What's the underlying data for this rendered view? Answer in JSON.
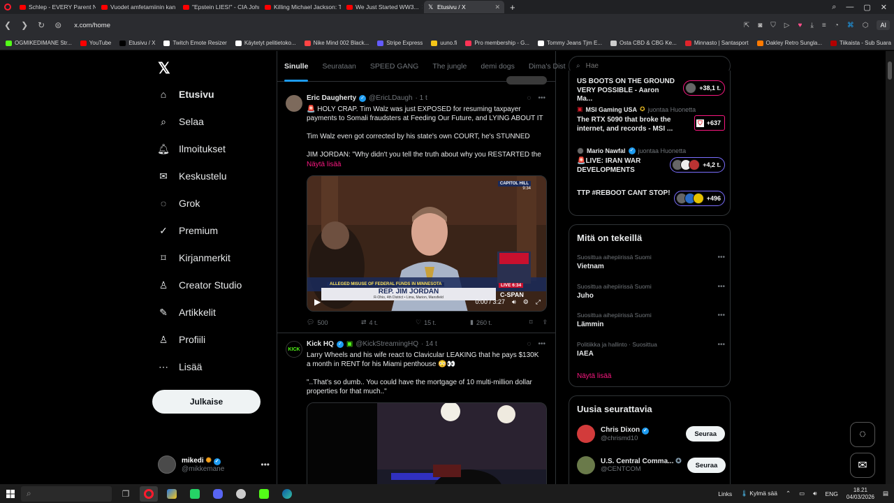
{
  "browser": {
    "tabs": [
      {
        "label": "Schlep - EVERY Parent Ne",
        "icon": "youtube-icon"
      },
      {
        "label": "Vuodet amfetamiinin kan",
        "icon": "youtube-icon"
      },
      {
        "label": "\"Epstein LIES!\" - CIA John",
        "icon": "youtube-icon"
      },
      {
        "label": "Killing Michael Jackson: Th",
        "icon": "youtube-icon"
      },
      {
        "label": "We Just Started WW3...",
        "icon": "youtube-icon"
      },
      {
        "label": "Etusivu / X",
        "icon": "x-icon",
        "active": true
      }
    ],
    "url": "x.com/home",
    "ai_label": "AI",
    "bookmarks": [
      {
        "label": "OGMIKEDIMANE Str...",
        "color": "#53fc18"
      },
      {
        "label": "YouTube",
        "color": "#ff0000"
      },
      {
        "label": "Etusivu / X",
        "color": "#000000"
      },
      {
        "label": "Twitch Emote Resizer",
        "color": "#ffffff"
      },
      {
        "label": "Käytetyt pelitietoko...",
        "color": "#ffffff"
      },
      {
        "label": "Nike Mind 002 Black...",
        "color": "#ff4444"
      },
      {
        "label": "Stripe Express",
        "color": "#635bff"
      },
      {
        "label": "uuno.fi",
        "color": "#f5c518"
      },
      {
        "label": "Pro membership - G...",
        "color": "#ff3355"
      },
      {
        "label": "Tommy Jeans Tjm E...",
        "color": "#ffffff"
      },
      {
        "label": "Osta CBD & CBG Ke...",
        "color": "#cccccc"
      },
      {
        "label": "Minnasto | Santasport",
        "color": "#e0242b"
      },
      {
        "label": "Oakley Retro Sungla...",
        "color": "#ff7a00"
      },
      {
        "label": "Tiikaista - Sub Suara",
        "color": "#b30000"
      }
    ]
  },
  "nav": {
    "items": [
      {
        "label": "Etusivu",
        "icon": "home-icon",
        "active": true
      },
      {
        "label": "Selaa",
        "icon": "search-icon"
      },
      {
        "label": "Ilmoitukset",
        "icon": "bell-icon"
      },
      {
        "label": "Keskustelu",
        "icon": "mail-icon"
      },
      {
        "label": "Grok",
        "icon": "grok-icon"
      },
      {
        "label": "Premium",
        "icon": "premium-icon"
      },
      {
        "label": "Kirjanmerkit",
        "icon": "bookmark-icon"
      },
      {
        "label": "Creator Studio",
        "icon": "creator-icon"
      },
      {
        "label": "Artikkelit",
        "icon": "article-icon"
      },
      {
        "label": "Profiili",
        "icon": "profile-icon"
      },
      {
        "label": "Lisää",
        "icon": "more-icon"
      }
    ],
    "post_label": "Julkaise",
    "profile": {
      "name": "mikedi",
      "handle": "@mikkemane"
    }
  },
  "feed": {
    "tabs": [
      "Sinulle",
      "Seurataan",
      "SPEED GANG",
      "The jungle",
      "demi dogs",
      "Dima's Dist"
    ],
    "tweets": [
      {
        "name": "Eric Daugherty",
        "handle": "@EricLDaugh",
        "time": "· 1 t",
        "text": "🚨 HOLY CRAP. Tim Walz was just EXPOSED for resuming taxpayer payments to Somali fraudsters at Feeding Our Future, and LYING ABOUT IT\n\nTim Walz even got corrected by his state's own COURT, he's STUNNED\n\nJIM JORDAN: \"Why didn't you tell the truth about why you RESTARTED the",
        "show_more": "Näytä lisää",
        "video": {
          "banner": "ALLEGED MISUSE OF FEDERAL FUNDS IN MINNESOTA",
          "name": "REP. JIM JORDAN",
          "sub": "R-Ohio, 4th District  •  Lima, Marion, Mansfield",
          "channel": "CAPITOL HILL",
          "channel_time": "9:34",
          "live": "LIVE",
          "live_time": "6:34",
          "network": "C-SPAN",
          "time": "0:00 / 3:27"
        },
        "stats": {
          "replies": "500",
          "reposts": "4 t.",
          "likes": "15 t.",
          "views": "260 t."
        }
      },
      {
        "name": "Kick HQ",
        "handle": "@KickStreamingHQ",
        "time": "· 14 t",
        "text": "Larry Wheels and his wife react to Clavicular LEAKING that he pays $130K a month in RENT for his Miami penthouse 😳👀\n\n\"..That's so dumb.. You could have the mortgage of 10 multi-million dollar properties for that much..\""
      }
    ]
  },
  "sidebar": {
    "search_placeholder": "Hae",
    "news": [
      {
        "title": "US BOOTS ON THE GROUND VERY POSSIBLE - Aaron Ma...",
        "count": "+38,1 t."
      },
      {
        "source": "MSI Gaming USA",
        "sub": "juontaa Huonetta",
        "title": "The RTX 5090 that broke the internet, and records - MSI ...",
        "count": "+637"
      },
      {
        "source": "Mario Nawfal",
        "sub": "juontaa Huonetta",
        "title": "🚨LIVE: IRAN WAR DEVELOPMENTS",
        "count": "+4,2 t."
      },
      {
        "title": "TTP #REBOOT CANT STOP!",
        "count": "+496"
      }
    ],
    "trends_title": "Mitä on tekeillä",
    "trends": [
      {
        "meta": "Suosittua aihepiirissä Suomi",
        "name": "Vietnam"
      },
      {
        "meta": "Suosittua aihepiirissä Suomi",
        "name": "Juho"
      },
      {
        "meta": "Suosittua aihepiirissä Suomi",
        "name": "Lämmin"
      },
      {
        "meta": "Politiikka ja hallinto · Suosittua",
        "name": "IAEA"
      }
    ],
    "show_more": "Näytä lisää",
    "follow_title": "Uusia seurattavia",
    "follow": [
      {
        "name": "Chris Dixon",
        "handle": "@chrismd10",
        "button": "Seuraa"
      },
      {
        "name": "U.S. Central Comma...",
        "handle": "@CENTCOM",
        "button": "Seuraa"
      }
    ]
  },
  "taskbar": {
    "links": "Links",
    "weather": "Kylmä sää",
    "lang": "ENG",
    "time": "18.21",
    "date": "04/03/2026"
  }
}
